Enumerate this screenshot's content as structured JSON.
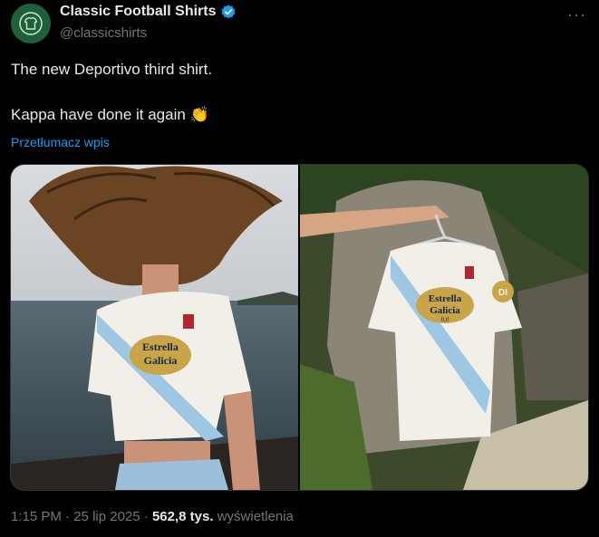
{
  "author": {
    "display_name": "Classic Football Shirts",
    "handle": "@classicshirts",
    "verified": true
  },
  "tweet": {
    "line1": "The new Deportivo third shirt.",
    "line2": "Kappa have done it again 👏",
    "translate_label": "Przetłumacz wpis"
  },
  "media": {
    "shirt_sponsor_line1": "Estrella",
    "shirt_sponsor_line2": "Galicia",
    "shirt_sponsor_sub": "0,0",
    "shirt_side_text": "DI"
  },
  "meta": {
    "time": "1:15 PM",
    "date": "25 lip 2025",
    "views_count": "562,8 tys.",
    "views_label": "wyświetlenia"
  },
  "colors": {
    "accent_link": "#1d9bf0",
    "avatar_bg": "#1f5f3a",
    "sash": "#9ec7e4",
    "shirt": "#f1efe8",
    "gold": "#c9a448"
  },
  "icons": {
    "verified": "verified-badge-icon",
    "more": "more-options-icon",
    "avatar": "shirt-logo-icon"
  }
}
